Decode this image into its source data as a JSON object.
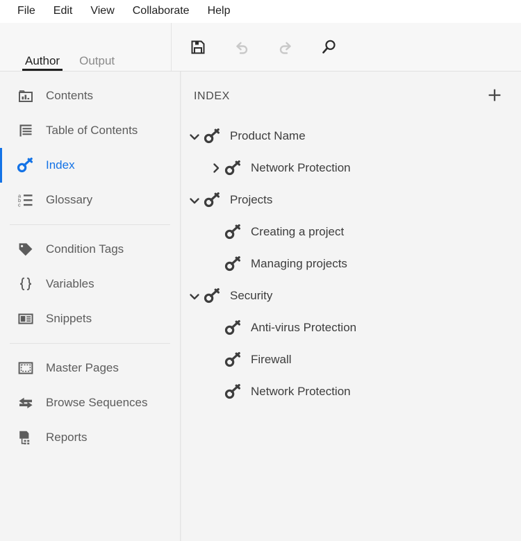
{
  "menubar": {
    "items": [
      {
        "label": "File"
      },
      {
        "label": "Edit"
      },
      {
        "label": "View"
      },
      {
        "label": "Collaborate"
      },
      {
        "label": "Help"
      }
    ]
  },
  "tabs": [
    {
      "label": "Author",
      "active": true
    },
    {
      "label": "Output",
      "active": false
    }
  ],
  "toolbar": {
    "buttons": [
      {
        "icon": "save-icon",
        "label": "Save",
        "enabled": true
      },
      {
        "icon": "undo-icon",
        "label": "Undo",
        "enabled": false
      },
      {
        "icon": "redo-icon",
        "label": "Redo",
        "enabled": false
      },
      {
        "icon": "search-icon",
        "label": "Search",
        "enabled": true
      }
    ]
  },
  "sidebar": {
    "groups": [
      {
        "items": [
          {
            "label": "Contents",
            "icon": "contents-icon",
            "selected": false
          },
          {
            "label": "Table of Contents",
            "icon": "table-of-contents-icon",
            "selected": false
          },
          {
            "label": "Index",
            "icon": "key-icon",
            "selected": true
          },
          {
            "label": "Glossary",
            "icon": "glossary-abc-icon",
            "selected": false
          }
        ]
      },
      {
        "items": [
          {
            "label": "Condition Tags",
            "icon": "tag-icon",
            "selected": false
          },
          {
            "label": "Variables",
            "icon": "braces-icon",
            "selected": false
          },
          {
            "label": "Snippets",
            "icon": "snippet-icon",
            "selected": false
          }
        ]
      },
      {
        "items": [
          {
            "label": "Master Pages",
            "icon": "master-pages-icon",
            "selected": false
          },
          {
            "label": "Browse Sequences",
            "icon": "browse-sequences-icon",
            "selected": false
          },
          {
            "label": "Reports",
            "icon": "reports-icon",
            "selected": false
          }
        ]
      }
    ]
  },
  "panel": {
    "title": "INDEX",
    "add_label": "+",
    "tree": [
      {
        "label": "Product Name",
        "level": 0,
        "twisty": "expanded",
        "icon": "key-icon"
      },
      {
        "label": "Network Protection",
        "level": 1,
        "twisty": "collapsed",
        "icon": "key-icon"
      },
      {
        "label": "Projects",
        "level": 0,
        "twisty": "expanded",
        "icon": "key-icon"
      },
      {
        "label": "Creating a project",
        "level": 1,
        "twisty": "none",
        "icon": "key-icon"
      },
      {
        "label": "Managing projects",
        "level": 1,
        "twisty": "none",
        "icon": "key-icon"
      },
      {
        "label": "Security",
        "level": 0,
        "twisty": "expanded",
        "icon": "key-icon"
      },
      {
        "label": "Anti-virus Protection",
        "level": 1,
        "twisty": "none",
        "icon": "key-icon"
      },
      {
        "label": "Firewall",
        "level": 1,
        "twisty": "none",
        "icon": "key-icon"
      },
      {
        "label": "Network Protection",
        "level": 1,
        "twisty": "none",
        "icon": "key-icon"
      }
    ]
  },
  "colors": {
    "accent": "#1473e6",
    "menubar_bg": "#ffffff",
    "toolbar_bg": "#f7f7f7",
    "panel_bg": "#f4f4f4",
    "text": "#3d3d3d",
    "muted_text": "#8a8a8a",
    "icon_gray": "#5c5c5c",
    "disabled_icon": "#c9c9c9"
  }
}
